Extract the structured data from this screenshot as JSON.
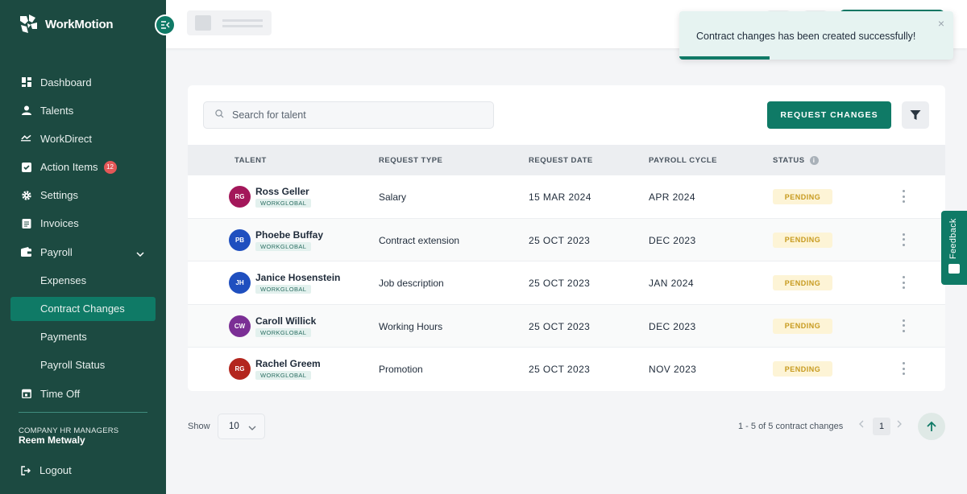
{
  "app": {
    "brand_name": "WorkMotion"
  },
  "sidebar": {
    "items": [
      {
        "label": "Dashboard",
        "icon": "dashboard-icon"
      },
      {
        "label": "Talents",
        "icon": "person-icon"
      },
      {
        "label": "WorkDirect",
        "icon": "transfer-arrows-icon"
      },
      {
        "label": "Action Items",
        "icon": "checkbox-icon",
        "badge": "12"
      },
      {
        "label": "Settings",
        "icon": "gear-icon"
      },
      {
        "label": "Invoices",
        "icon": "document-icon"
      },
      {
        "label": "Payroll",
        "icon": "wallet-icon",
        "expanded": true
      },
      {
        "label": "Expenses"
      },
      {
        "label": "Contract Changes",
        "active": true
      },
      {
        "label": "Payments"
      },
      {
        "label": "Payroll Status"
      },
      {
        "label": "Time Off",
        "icon": "calendar-icon"
      }
    ],
    "role": "COMPANY HR MANAGERS",
    "user_name": "Reem Metwaly",
    "logout_label": "Logout"
  },
  "toast": {
    "message": "Contract changes has been created successfully!",
    "close": "×",
    "progress": 0.33
  },
  "toolbar": {
    "search_placeholder": "Search for talent",
    "request_changes_label": "REQUEST CHANGES"
  },
  "table": {
    "columns": [
      "TALENT",
      "REQUEST TYPE",
      "REQUEST DATE",
      "PAYROLL CYCLE",
      "STATUS"
    ],
    "rows": [
      {
        "initials": "RG",
        "avatar_color": "#a3175a",
        "name": "Ross Geller",
        "tag": "WORKGLOBAL",
        "request_type": "Salary",
        "request_date": "15 MAR 2024",
        "payroll_cycle": "APR 2024",
        "status": "PENDING"
      },
      {
        "initials": "PB",
        "avatar_color": "#1f4fbf",
        "name": "Phoebe Buffay",
        "tag": "WORKGLOBAL",
        "request_type": "Contract extension",
        "request_date": "25 OCT 2023",
        "payroll_cycle": "DEC 2023",
        "status": "PENDING"
      },
      {
        "initials": "JH",
        "avatar_color": "#1f4fbf",
        "name": "Janice Hosenstein",
        "tag": "WORKGLOBAL",
        "request_type": "Job description",
        "request_date": "25 OCT 2023",
        "payroll_cycle": "JAN 2024",
        "status": "PENDING"
      },
      {
        "initials": "CW",
        "avatar_color": "#7b2f95",
        "name": "Caroll Willick",
        "tag": "WORKGLOBAL",
        "request_type": "Working Hours",
        "request_date": "25 OCT 2023",
        "payroll_cycle": "DEC 2023",
        "status": "PENDING"
      },
      {
        "initials": "RG",
        "avatar_color": "#b3261e",
        "name": "Rachel Greem",
        "tag": "WORKGLOBAL",
        "request_type": "Promotion",
        "request_date": "25 OCT 2023",
        "payroll_cycle": "NOV 2023",
        "status": "PENDING"
      }
    ]
  },
  "pagination": {
    "show_label": "Show",
    "page_size": "10",
    "count_text": "1 - 5 of 5 contract changes",
    "current_page": "1"
  },
  "feedback": {
    "label": "Feedback"
  },
  "colors": {
    "sidebar_bg": "#1c4a41",
    "accent": "#0f7a66",
    "pending_bg": "#fdf4d6",
    "pending_text": "#c79a1e"
  }
}
